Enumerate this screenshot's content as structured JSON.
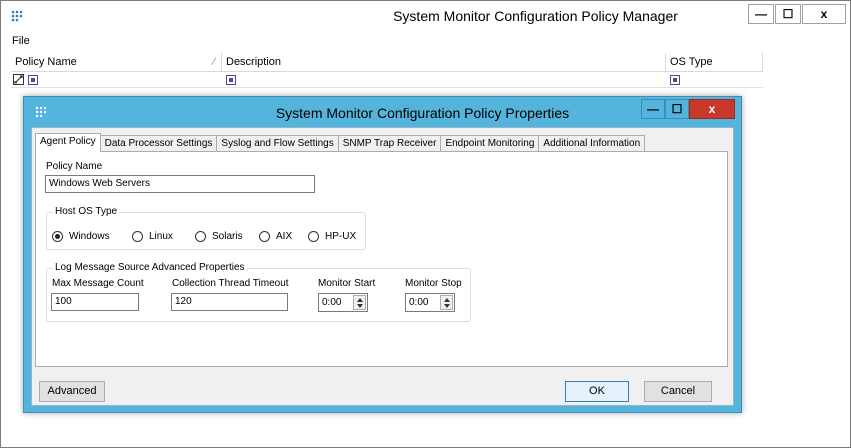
{
  "main_window": {
    "title": "System Monitor Configuration Policy Manager",
    "controls": {
      "minimize": "—",
      "maximize": "☐",
      "close": "x"
    }
  },
  "menu": {
    "items": [
      "File"
    ]
  },
  "grid": {
    "columns": [
      "Policy Name",
      "Description",
      "OS Type"
    ],
    "sort_indicator": "⁄"
  },
  "dialog": {
    "title": "System Monitor Configuration Policy Properties",
    "controls": {
      "minimize": "—",
      "maximize": "☐",
      "close": "x"
    },
    "tabs": [
      "Agent Policy",
      "Data Processor Settings",
      "Syslog and Flow Settings",
      "SNMP Trap Receiver",
      "Endpoint Monitoring",
      "Additional Information"
    ],
    "active_tab": "Agent Policy",
    "policy_name_label": "Policy Name",
    "policy_name_value": "Windows Web Servers",
    "host_os": {
      "title": "Host OS Type",
      "options": [
        "Windows",
        "Linux",
        "Solaris",
        "AIX",
        "HP-UX"
      ],
      "selected": "Windows"
    },
    "log_props": {
      "title": "Log Message Source Advanced Properties",
      "max_count_label": "Max Message Count",
      "max_count_value": "100",
      "timeout_label": "Collection Thread Timeout",
      "timeout_value": "120",
      "start_label": "Monitor Start",
      "start_value": "0:00",
      "stop_label": "Monitor Stop",
      "stop_value": "0:00"
    },
    "buttons": {
      "advanced": "Advanced",
      "ok": "OK",
      "cancel": "Cancel"
    }
  },
  "colors": {
    "dialog_titlebar": "#55b4dc",
    "close_button": "#c8392b"
  },
  "icons": [
    "app-dots-icon",
    "row-edit-icon",
    "checkbox-icon"
  ]
}
